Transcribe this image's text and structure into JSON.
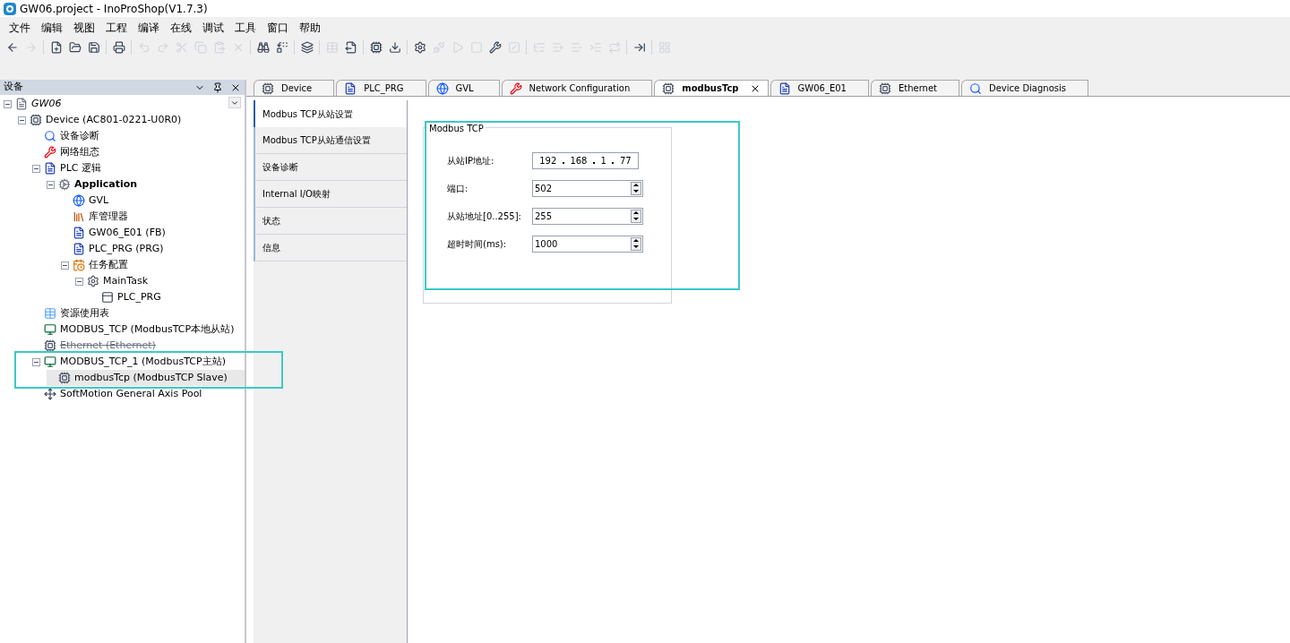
{
  "window": {
    "title": "GW06.project - InoProShop(V1.7.3)"
  },
  "menu": [
    "文件",
    "编辑",
    "视图",
    "工程",
    "编译",
    "在线",
    "调试",
    "工具",
    "窗口",
    "帮助"
  ],
  "toolbar": [
    [
      {
        "disabled": false
      },
      {
        "disabled": true
      }
    ],
    [
      {
        "disabled": false
      },
      {
        "disabled": false
      },
      {
        "disabled": false
      }
    ],
    [
      {
        "disabled": false
      }
    ],
    [
      {
        "disabled": true
      },
      {
        "disabled": true
      },
      {
        "disabled": true
      },
      {
        "disabled": true
      },
      {
        "disabled": true
      },
      {
        "disabled": true
      }
    ],
    [
      {
        "disabled": false
      },
      {
        "disabled": false
      }
    ],
    [
      {
        "disabled": false
      }
    ],
    [
      {
        "disabled": true
      },
      {
        "disabled": false
      }
    ],
    [
      {
        "disabled": false
      },
      {
        "disabled": false
      }
    ],
    [
      {
        "disabled": false
      },
      {
        "disabled": true
      },
      {
        "disabled": true
      },
      {
        "disabled": true
      },
      {
        "disabled": false
      },
      {
        "disabled": true
      }
    ],
    [
      {
        "disabled": true
      },
      {
        "disabled": true
      },
      {
        "disabled": true
      },
      {
        "disabled": true
      },
      {
        "disabled": true
      }
    ],
    [
      {
        "disabled": false
      }
    ],
    [
      {
        "disabled": true
      }
    ]
  ],
  "device_panel": {
    "title": "设备",
    "tree": [
      {
        "label": "GW06",
        "kind": "project",
        "italic": true,
        "expanded": true,
        "selected": false,
        "disabled": false,
        "children": [
          {
            "label": "Device (AC801-0221-U0R0)",
            "kind": "device",
            "expanded": true,
            "selected": false,
            "disabled": false,
            "children": [
              {
                "label": "设备诊断",
                "kind": "search",
                "selected": false,
                "disabled": false
              },
              {
                "label": "网络组态",
                "kind": "tools",
                "selected": false,
                "disabled": false
              },
              {
                "label": "PLC 逻辑",
                "kind": "plc",
                "expanded": true,
                "selected": false,
                "disabled": false,
                "children": [
                  {
                    "label": "Application",
                    "kind": "app",
                    "bold": true,
                    "expanded": true,
                    "selected": false,
                    "disabled": false,
                    "children": [
                      {
                        "label": "GVL",
                        "kind": "globe",
                        "selected": false,
                        "disabled": false
                      },
                      {
                        "label": "库管理器",
                        "kind": "library",
                        "selected": false,
                        "disabled": false
                      },
                      {
                        "label": "GW06_E01 (FB)",
                        "kind": "doc",
                        "selected": false,
                        "disabled": false
                      },
                      {
                        "label": "PLC_PRG (PRG)",
                        "kind": "doc",
                        "selected": false,
                        "disabled": false
                      },
                      {
                        "label": "任务配置",
                        "kind": "task",
                        "expanded": true,
                        "selected": false,
                        "disabled": false,
                        "children": [
                          {
                            "label": "MainTask",
                            "kind": "gear",
                            "expanded": true,
                            "selected": false,
                            "disabled": false,
                            "children": [
                              {
                                "label": "PLC_PRG",
                                "kind": "call",
                                "selected": false,
                                "disabled": false
                              }
                            ]
                          }
                        ]
                      }
                    ]
                  }
                ]
              },
              {
                "label": "资源使用表",
                "kind": "table",
                "selected": false,
                "disabled": false
              },
              {
                "label": "MODBUS_TCP (ModbusTCP本地从站)",
                "kind": "module",
                "selected": false,
                "disabled": false
              },
              {
                "label": "Ethernet (Ethernet)",
                "kind": "device",
                "selected": false,
                "disabled": true
              },
              {
                "label": "MODBUS_TCP_1 (ModbusTCP主站)",
                "kind": "module",
                "expanded": true,
                "selected": false,
                "disabled": false,
                "children": [
                  {
                    "label": "modbusTcp (ModbusTCP Slave)",
                    "kind": "device",
                    "selected": true,
                    "disabled": false
                  }
                ]
              },
              {
                "label": "SoftMotion General Axis Pool",
                "kind": "axis",
                "selected": false,
                "disabled": false
              }
            ]
          }
        ]
      }
    ]
  },
  "editor_tabs": [
    {
      "label": "Device",
      "kind": "device",
      "selected": false
    },
    {
      "label": "PLC_PRG",
      "kind": "doc",
      "selected": false
    },
    {
      "label": "GVL",
      "kind": "globe",
      "selected": false
    },
    {
      "label": "Network Configuration",
      "kind": "tools",
      "selected": false
    },
    {
      "label": "modbusTcp",
      "kind": "device",
      "selected": true
    },
    {
      "label": "GW06_E01",
      "kind": "doc",
      "selected": false
    },
    {
      "label": "Ethernet",
      "kind": "device",
      "selected": false
    },
    {
      "label": "Device Diagnosis",
      "kind": "search",
      "selected": false
    }
  ],
  "page_tabs": [
    {
      "label": "Modbus TCP从站设置",
      "selected": true
    },
    {
      "label": "Modbus TCP从站通信设置",
      "selected": false
    },
    {
      "label": "设备诊断",
      "selected": false
    },
    {
      "label": "Internal I/O映射",
      "selected": false
    },
    {
      "label": "状态",
      "selected": false
    },
    {
      "label": "信息",
      "selected": false
    }
  ],
  "group": {
    "title": "Modbus TCP",
    "fields": [
      {
        "label": "从站IP地址:",
        "kind": "ip",
        "octets": [
          "192",
          "168",
          "1",
          "77"
        ]
      },
      {
        "label": "端口:",
        "kind": "spin",
        "value": "502"
      },
      {
        "label": "从站地址[0..255]:",
        "kind": "spin",
        "value": "255"
      },
      {
        "label": "超时时间(ms):",
        "kind": "spin",
        "value": "1000"
      }
    ]
  }
}
